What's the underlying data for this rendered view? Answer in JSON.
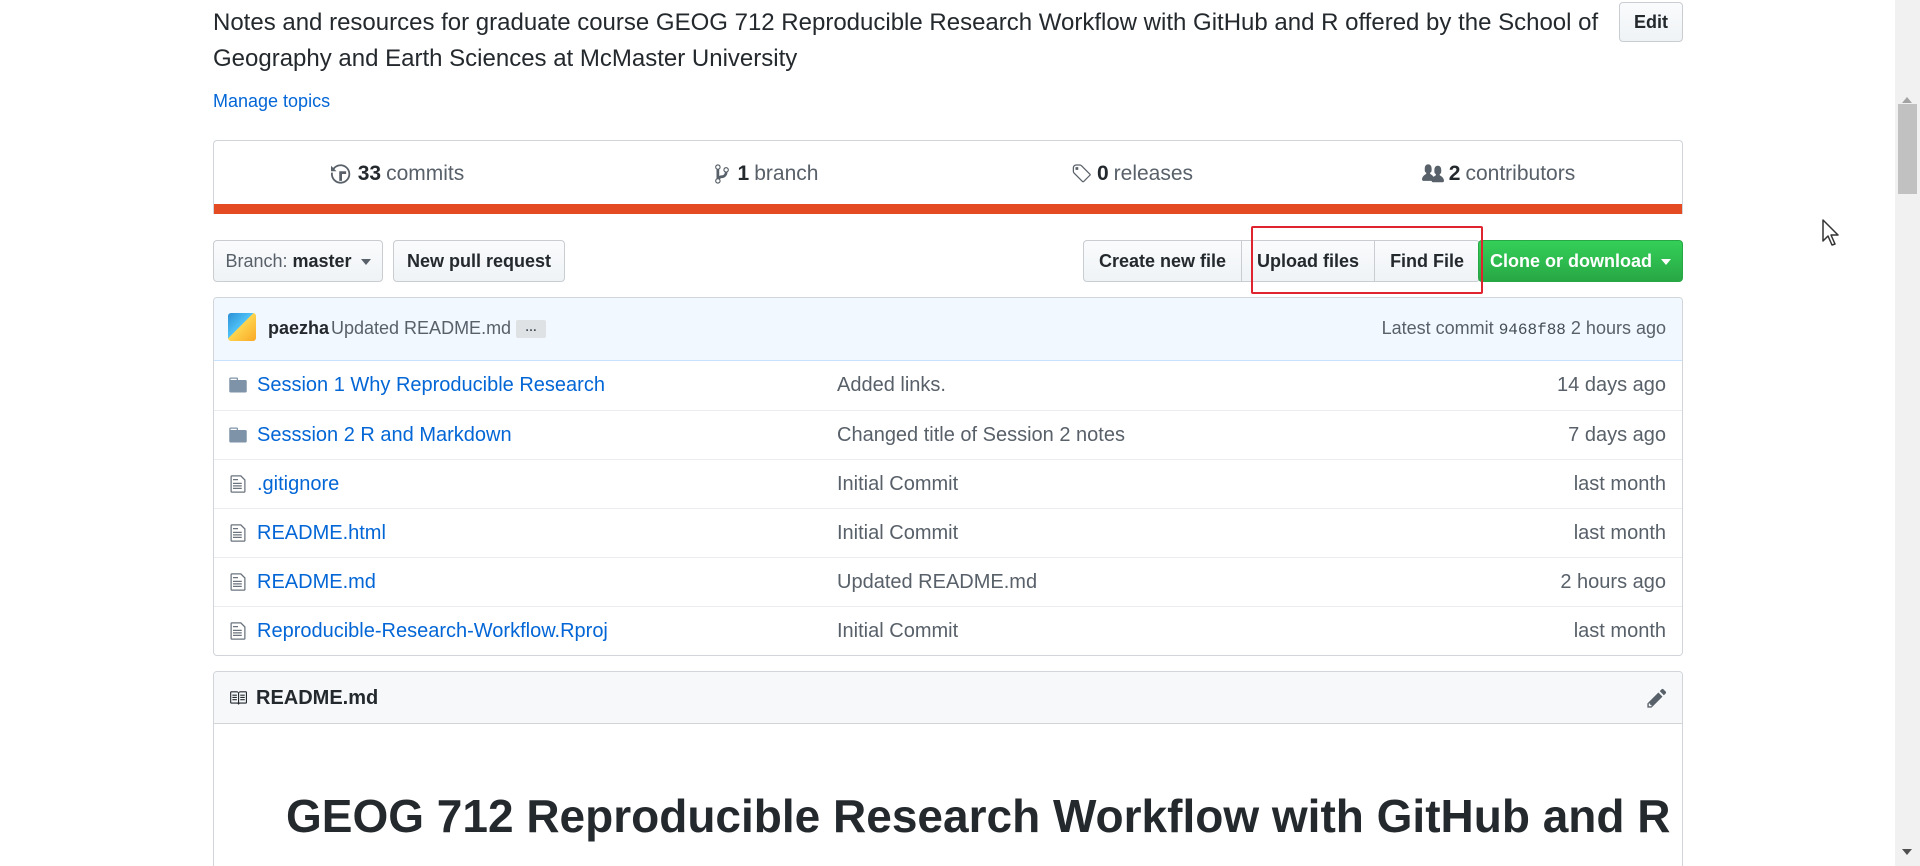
{
  "repo": {
    "description": "Notes and resources for graduate course GEOG 712 Reproducible Research Workflow with GitHub and R offered by the School of Geography and Earth Sciences at McMaster University",
    "edit_label": "Edit",
    "manage_topics_label": "Manage topics"
  },
  "summary": {
    "commits_count": "33",
    "commits_label": "commits",
    "branches_count": "1",
    "branches_label": "branch",
    "releases_count": "0",
    "releases_label": "releases",
    "contributors_count": "2",
    "contributors_label": "contributors",
    "language_color": "#e44b23"
  },
  "toolbar": {
    "branch_prefix": "Branch:",
    "branch_name": "master",
    "new_pull_request": "New pull request",
    "create_new_file": "Create new file",
    "upload_files": "Upload files",
    "find_file": "Find File",
    "clone_or_download": "Clone or download"
  },
  "latest_commit": {
    "author": "paezha",
    "message": "Updated README.md",
    "ellipsis": "…",
    "prefix": "Latest commit",
    "sha": "9468f88",
    "age": "2 hours ago"
  },
  "files": [
    {
      "type": "folder",
      "icon": "folder-icon",
      "name": "Session 1 Why Reproducible Research",
      "message": "Added links.",
      "age": "14 days ago"
    },
    {
      "type": "folder",
      "icon": "folder-icon",
      "name": "Sesssion 2 R and Markdown",
      "message": "Changed title of Session 2 notes",
      "age": "7 days ago"
    },
    {
      "type": "file",
      "icon": "file-icon",
      "name": ".gitignore",
      "message": "Initial Commit",
      "age": "last month"
    },
    {
      "type": "file",
      "icon": "file-icon",
      "name": "README.html",
      "message": "Initial Commit",
      "age": "last month"
    },
    {
      "type": "file",
      "icon": "file-icon",
      "name": "README.md",
      "message": "Updated README.md",
      "age": "2 hours ago"
    },
    {
      "type": "file",
      "icon": "file-icon",
      "name": "Reproducible-Research-Workflow.Rproj",
      "message": "Initial Commit",
      "age": "last month"
    }
  ],
  "readme": {
    "filename": "README.md",
    "heading": "GEOG 712 Reproducible Research Workflow with GitHub and R"
  },
  "colors": {
    "link": "#0366d6",
    "clone_button": "#28a745",
    "highlight": "#e0242f"
  }
}
